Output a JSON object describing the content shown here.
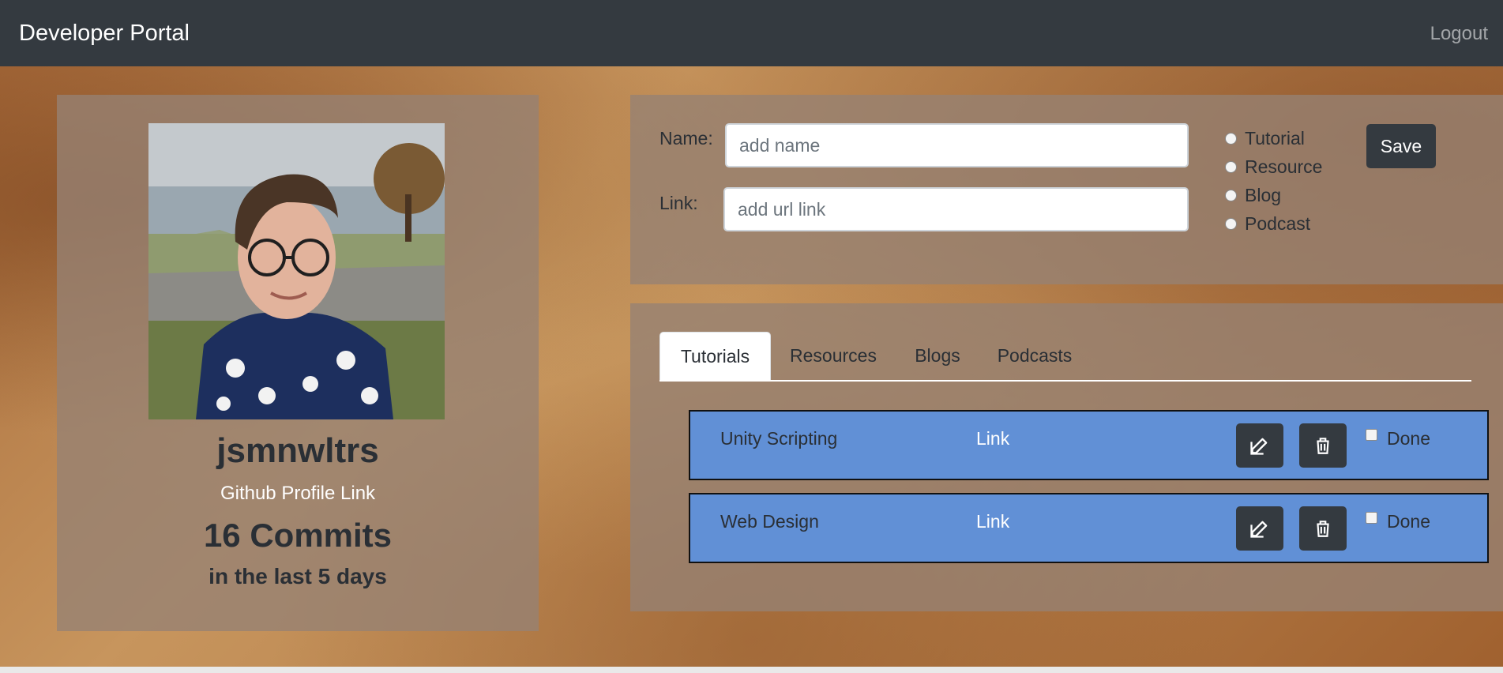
{
  "navbar": {
    "brand": "Developer Portal",
    "logout": "Logout"
  },
  "profile": {
    "username": "jsmnwltrs",
    "github_link": "Github Profile Link",
    "commits": "16 Commits",
    "commits_period": "in the last 5 days"
  },
  "form": {
    "name_label": "Name:",
    "name_placeholder": "add name",
    "link_label": "Link:",
    "link_placeholder": "add url link",
    "types": [
      "Tutorial",
      "Resource",
      "Blog",
      "Podcast"
    ],
    "save_label": "Save"
  },
  "tabs": [
    "Tutorials",
    "Resources",
    "Blogs",
    "Podcasts"
  ],
  "active_tab": "Tutorials",
  "items": [
    {
      "title": "Unity Scripting",
      "link": "Link",
      "done_label": "Done",
      "done": false
    },
    {
      "title": "Web Design",
      "link": "Link",
      "done_label": "Done",
      "done": false
    }
  ],
  "colors": {
    "navbar": "#343a40",
    "item_background": "#6190d6",
    "button": "#343a40"
  },
  "icons": {
    "edit": "edit-icon",
    "delete": "trash-icon"
  }
}
